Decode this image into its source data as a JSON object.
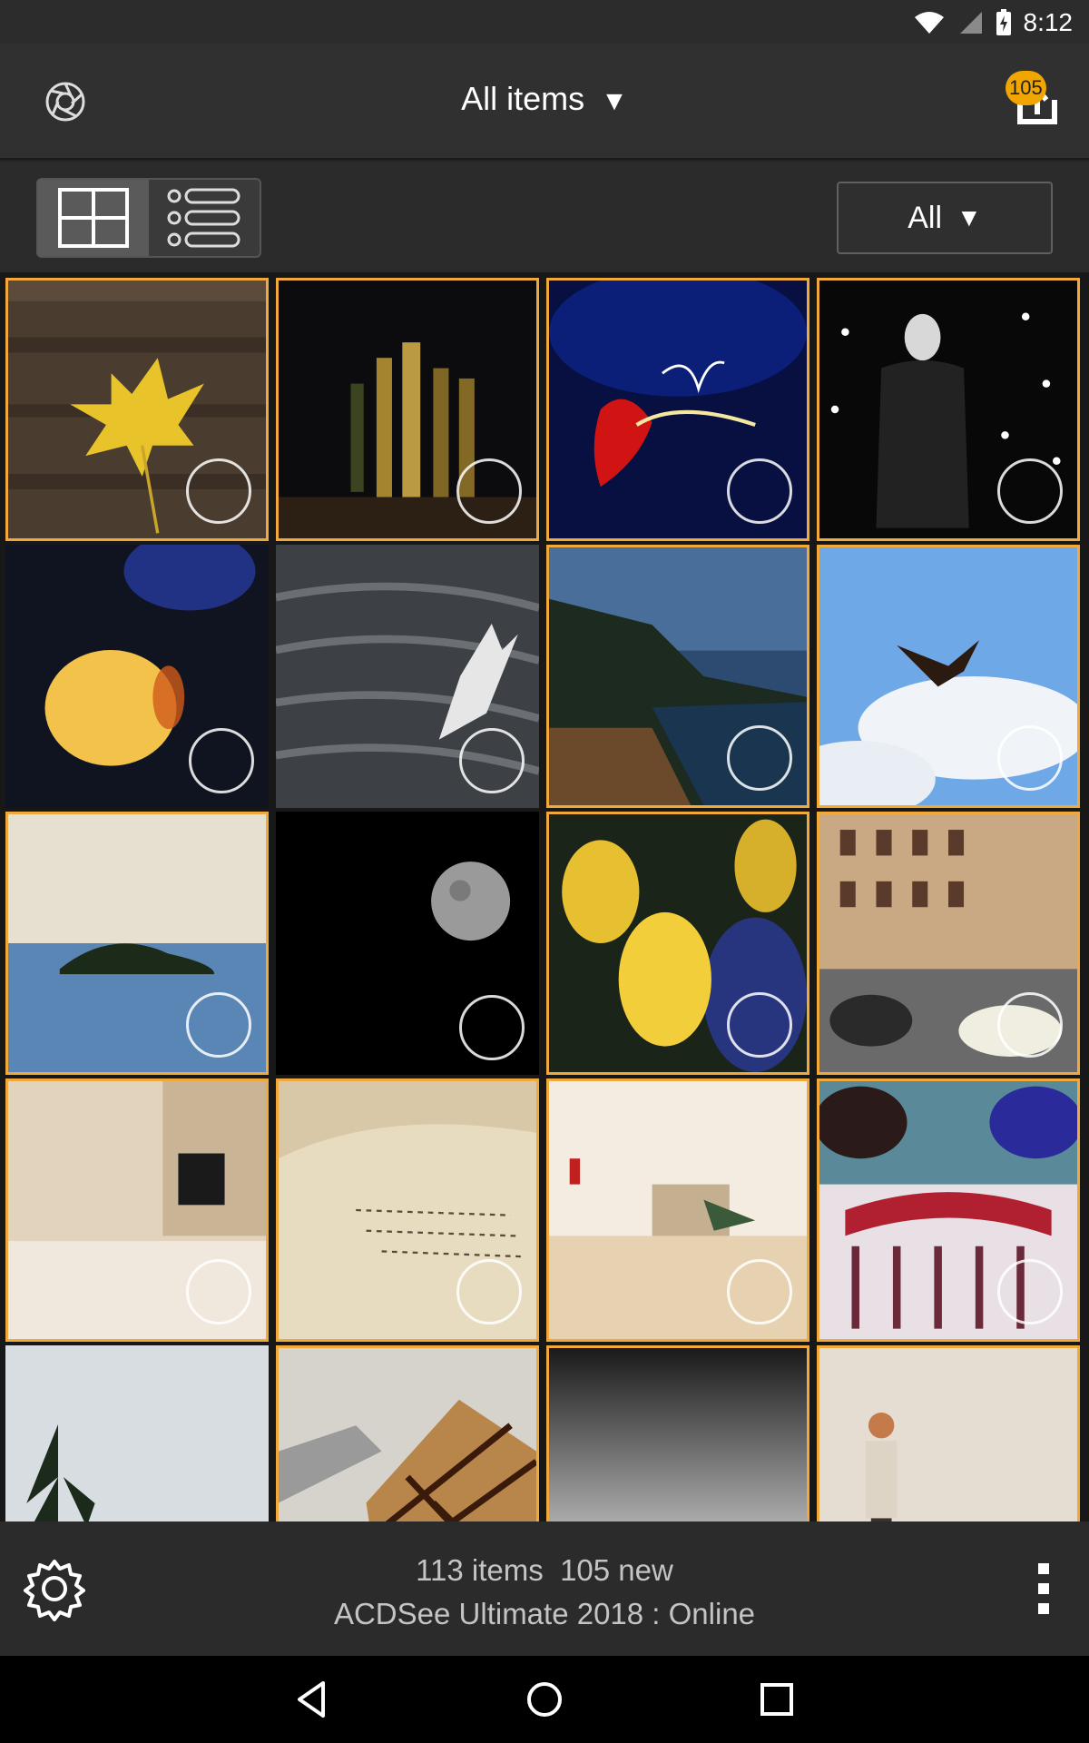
{
  "status_bar": {
    "time": "8:12",
    "icons": [
      "wifi-icon",
      "signal-icon",
      "battery-charging-icon"
    ]
  },
  "app_bar": {
    "title": "All items",
    "title_arrow": "▼",
    "logo_icon": "aperture-logo-icon",
    "upload_icon": "upload-icon",
    "upload_badge": "105"
  },
  "toolbar": {
    "grid_view_icon": "grid-view-icon",
    "list_view_icon": "list-view-icon",
    "active_view": "grid",
    "filter_label": "All",
    "filter_arrow": "▼"
  },
  "grid": {
    "accent_color": "#f2a93b",
    "items": [
      {
        "subject": "maple leaf on wooden deck",
        "selected": true
      },
      {
        "subject": "bottles in dark",
        "selected": true
      },
      {
        "subject": "light painting blue red",
        "selected": true
      },
      {
        "subject": "mannequin with coat",
        "selected": true
      },
      {
        "subject": "yellow tulip on blue",
        "selected": false
      },
      {
        "subject": "seagull over water",
        "selected": false
      },
      {
        "subject": "coastline at dusk",
        "selected": true
      },
      {
        "subject": "bird in blue sky",
        "selected": true
      },
      {
        "subject": "small island in sea",
        "selected": true
      },
      {
        "subject": "moon in black sky",
        "selected": false
      },
      {
        "subject": "yellow tulips",
        "selected": true
      },
      {
        "subject": "old street with cars",
        "selected": true
      },
      {
        "subject": "beige interior",
        "selected": true
      },
      {
        "subject": "open book pages",
        "selected": true
      },
      {
        "subject": "bright hall interior",
        "selected": true
      },
      {
        "subject": "graffiti face",
        "selected": true
      },
      {
        "subject": "snowy trees",
        "selected": false
      },
      {
        "subject": "chocolate cake",
        "selected": true
      },
      {
        "subject": "grey gradient",
        "selected": true
      },
      {
        "subject": "person on sand",
        "selected": true
      }
    ]
  },
  "bottom_bar": {
    "count_line": "113 items  105 new",
    "source_line": "ACDSee Ultimate 2018 : Online",
    "settings_icon": "gear-icon",
    "more_icon": "more-vert-icon"
  },
  "nav_bar": {
    "icons": [
      "back-icon",
      "home-icon",
      "recents-icon"
    ]
  }
}
